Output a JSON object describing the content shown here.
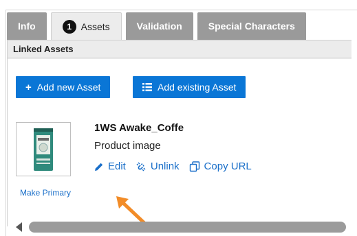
{
  "tabs": [
    {
      "label": "Info"
    },
    {
      "label": "Assets",
      "count": "1"
    },
    {
      "label": "Validation"
    },
    {
      "label": "Special Characters"
    }
  ],
  "linked_assets": {
    "title": "Linked Assets",
    "add_new_label": "Add new Asset",
    "add_existing_label": "Add existing Asset"
  },
  "asset": {
    "name": "1WS Awake_Coffe",
    "type": "Product image",
    "make_primary": "Make Primary",
    "actions": {
      "edit": "Edit",
      "unlink": "Unlink",
      "copy_url": "Copy URL"
    }
  },
  "colors": {
    "accent": "#0a76d6",
    "link": "#1a6fc9",
    "annotation_arrow": "#f28c28"
  }
}
